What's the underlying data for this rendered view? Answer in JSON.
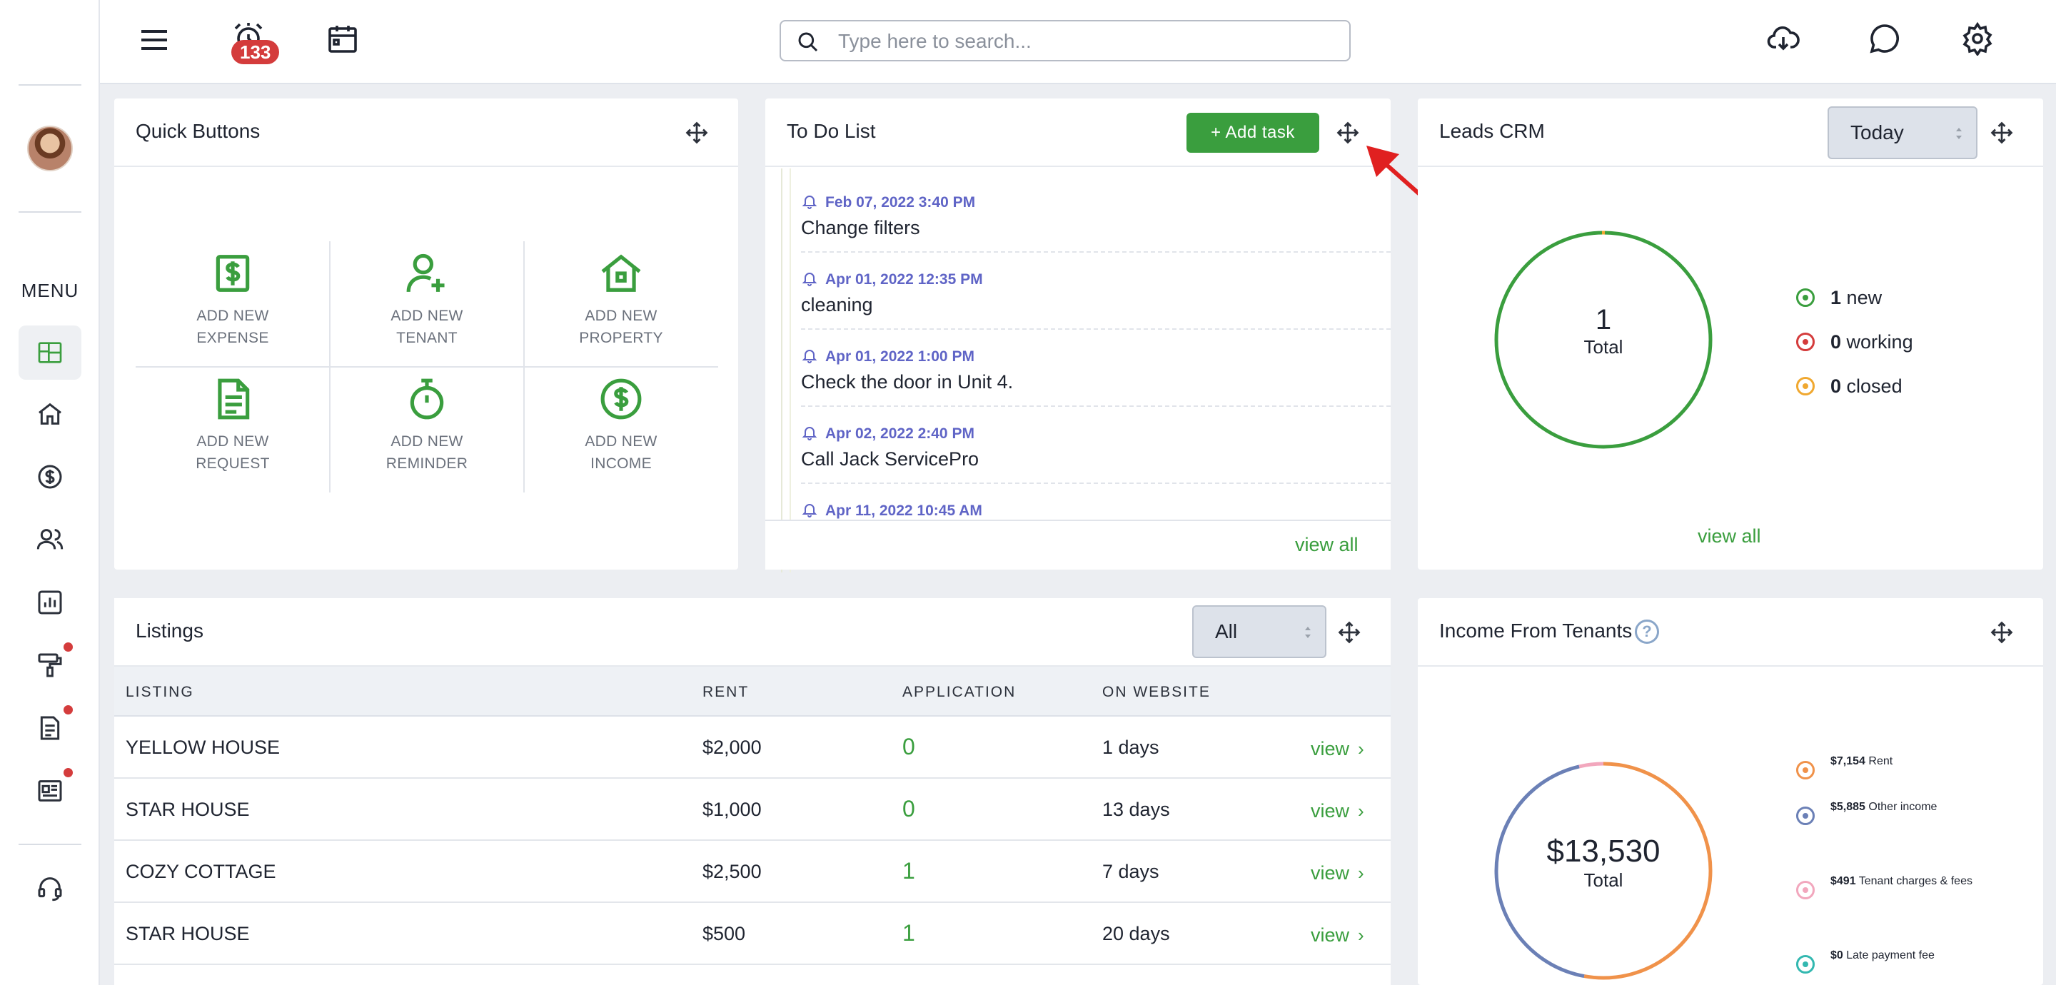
{
  "topbar": {
    "notification_count": "133",
    "search_placeholder": "Type here to search..."
  },
  "sidebar": {
    "menu_label": "MENU",
    "items": [
      {
        "name": "dashboard-icon"
      },
      {
        "name": "home-icon"
      },
      {
        "name": "dollar-icon"
      },
      {
        "name": "people-icon"
      },
      {
        "name": "chart-icon"
      },
      {
        "name": "paint-roller-icon"
      },
      {
        "name": "document-icon"
      },
      {
        "name": "news-icon"
      },
      {
        "name": "headset-icon"
      }
    ]
  },
  "quick_buttons": {
    "title": "Quick Buttons",
    "items": [
      {
        "line1": "ADD NEW",
        "line2": "EXPENSE",
        "icon": "dollar-bill-icon"
      },
      {
        "line1": "ADD NEW",
        "line2": "TENANT",
        "icon": "add-user-icon"
      },
      {
        "line1": "ADD NEW",
        "line2": "PROPERTY",
        "icon": "house-icon"
      },
      {
        "line1": "ADD NEW",
        "line2": "REQUEST",
        "icon": "document-icon"
      },
      {
        "line1": "ADD NEW",
        "line2": "REMINDER",
        "icon": "stopwatch-icon"
      },
      {
        "line1": "ADD NEW",
        "line2": "INCOME",
        "icon": "dollar-circle-icon"
      }
    ]
  },
  "todo": {
    "title": "To Do List",
    "add_label": "+ Add task",
    "view_all": "view all",
    "items": [
      {
        "date": "Feb 07, 2022 3:40 PM",
        "text": "Change filters"
      },
      {
        "date": "Apr 01, 2022 12:35 PM",
        "text": "cleaning"
      },
      {
        "date": "Apr 01, 2022 1:00 PM",
        "text": "Check the door in Unit 4."
      },
      {
        "date": "Apr 02, 2022 2:40 PM",
        "text": "Call Jack ServicePro"
      },
      {
        "date": "Apr 11, 2022 10:45 AM",
        "text": ""
      }
    ]
  },
  "leads": {
    "title": "Leads CRM",
    "period": "Today",
    "total_value": "1",
    "total_label": "Total",
    "view_all": "view all",
    "legend": [
      {
        "count": "1",
        "label": "new",
        "color": "#3a9e3e"
      },
      {
        "count": "0",
        "label": "working",
        "color": "#d43c3c"
      },
      {
        "count": "0",
        "label": "closed",
        "color": "#f0a830"
      }
    ]
  },
  "listings": {
    "title": "Listings",
    "filter": "All",
    "columns": [
      "LISTING",
      "RENT",
      "APPLICATION",
      "ON WEBSITE"
    ],
    "view_label": "view",
    "rows": [
      {
        "listing": "YELLOW HOUSE",
        "rent": "$2,000",
        "application": "0",
        "on_website": "1 days"
      },
      {
        "listing": "STAR HOUSE",
        "rent": "$1,000",
        "application": "0",
        "on_website": "13 days"
      },
      {
        "listing": "COZY COTTAGE",
        "rent": "$2,500",
        "application": "1",
        "on_website": "7 days"
      },
      {
        "listing": "STAR HOUSE",
        "rent": "$500",
        "application": "1",
        "on_website": "20 days"
      }
    ]
  },
  "income": {
    "title": "Income From Tenants",
    "total_value": "$13,530",
    "total_label": "Total",
    "legend": [
      {
        "amount": "$7,154",
        "label": "Rent",
        "color": "#f0924a",
        "value": 7154
      },
      {
        "amount": "$5,885",
        "label": "Other income",
        "color": "#6b80b6",
        "value": 5885
      },
      {
        "amount": "$491",
        "label": "Tenant charges & fees",
        "color": "#f2a7bd",
        "value": 491
      },
      {
        "amount": "$0",
        "label": "Late payment fee",
        "color": "#33b8b0",
        "value": 0
      }
    ]
  }
}
